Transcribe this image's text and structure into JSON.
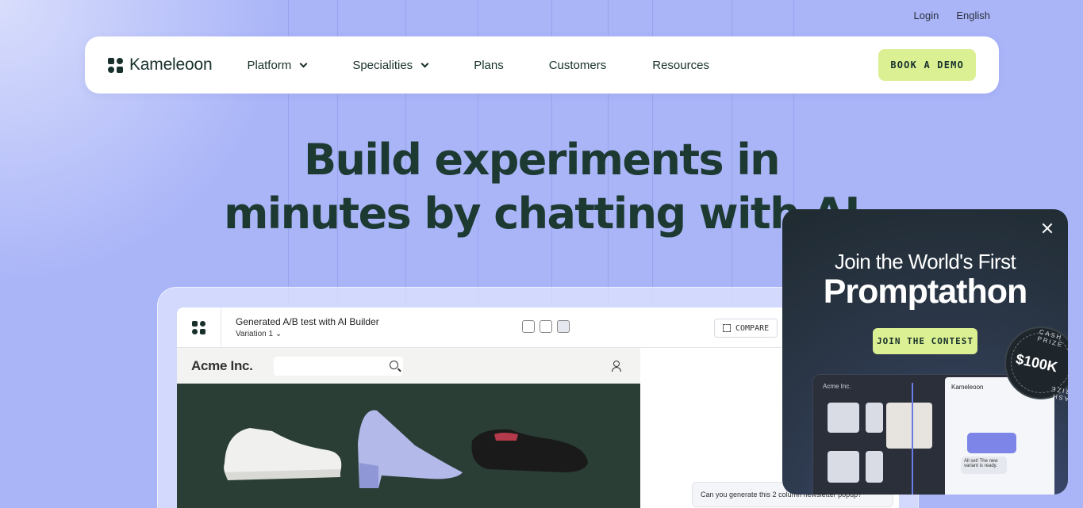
{
  "topbar": {
    "login": "Login",
    "language": "English"
  },
  "nav": {
    "brand": "Kameleoon",
    "items": [
      {
        "label": "Platform",
        "dropdown": true
      },
      {
        "label": "Specialities",
        "dropdown": true
      },
      {
        "label": "Plans",
        "dropdown": false
      },
      {
        "label": "Customers",
        "dropdown": false
      },
      {
        "label": "Resources",
        "dropdown": false
      }
    ],
    "cta": "BOOK A DEMO"
  },
  "hero": {
    "line1": "Build experiments in",
    "line2": "minutes by chatting with AI"
  },
  "mockup": {
    "title": "Generated A/B test with AI Builder",
    "variation": "Variation 1",
    "compare_label": "COMPARE",
    "shop_name": "Acme Inc.",
    "chat_prompt": "Can you generate this 2 column newsletter popup?"
  },
  "popup": {
    "line1": "Join the World's First",
    "line2": "Promptathon",
    "cta": "JOIN THE CONTEST",
    "prize_amount": "$100K",
    "prize_ring_top": "CASH PRIZE",
    "prize_ring_bottom": "CASH PRIZE",
    "screen_shop": "Acme Inc.",
    "screen_brand": "Kameleoon",
    "screen_reply": "All set! The new variant is ready."
  },
  "colors": {
    "background": "#aab5f8",
    "accent": "#dbef93",
    "text_dark": "#1d3a32",
    "popup_bg": "#2e3a4e"
  }
}
